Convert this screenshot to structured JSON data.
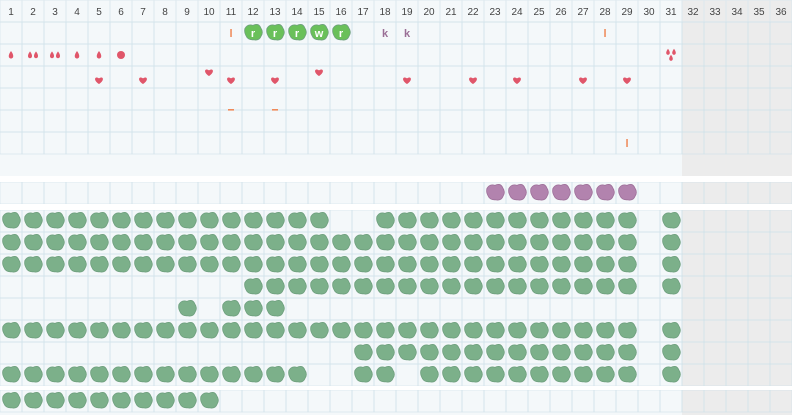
{
  "colors": {
    "page_bg": "#f4f8fa",
    "cell_border": "#dde8ee",
    "grid_line": "#cfe2ea",
    "band_separator": "#ffffff",
    "shaded_bg": "#ececec",
    "day_number_text": "#444444",
    "blob_green": "#7cb08a",
    "blob_green_dark": "#6e9f7e",
    "blob_bright_green": "#6ac05a",
    "blob_purple": "#b283ae",
    "symbol_red": "#e0566a",
    "symbol_orange": "#ef8a5a",
    "letter_purple": "#9a6f96",
    "letter_on_blob": "#ffffff"
  },
  "days": [
    "1",
    "2",
    "3",
    "4",
    "5",
    "6",
    "7",
    "8",
    "9",
    "10",
    "11",
    "12",
    "13",
    "14",
    "15",
    "16",
    "17",
    "18",
    "19",
    "20",
    "21",
    "22",
    "23",
    "24",
    "25",
    "26",
    "27",
    "28",
    "29",
    "30",
    "31",
    "32",
    "33",
    "34",
    "35",
    "36"
  ],
  "active_day_count": 31,
  "tracks": [
    {
      "name": "track-1",
      "band": 1,
      "blobs": [],
      "letters": [
        {
          "day": 11,
          "text": "l",
          "style": "plain-orange"
        },
        {
          "day": 12,
          "text": "r",
          "style": "on-blob"
        },
        {
          "day": 13,
          "text": "r",
          "style": "on-blob"
        },
        {
          "day": 14,
          "text": "r",
          "style": "on-blob"
        },
        {
          "day": 15,
          "text": "w",
          "style": "on-blob"
        },
        {
          "day": 16,
          "text": "r",
          "style": "on-blob"
        },
        {
          "day": 18,
          "text": "k",
          "style": "plain-purple"
        },
        {
          "day": 19,
          "text": "k",
          "style": "plain-purple"
        },
        {
          "day": 28,
          "text": "l",
          "style": "plain-orange"
        }
      ],
      "symbols": []
    },
    {
      "name": "track-2",
      "band": 1,
      "blobs": [],
      "letters": [],
      "symbols": [
        {
          "day": 1,
          "type": "drop",
          "count": 1
        },
        {
          "day": 2,
          "type": "drop",
          "count": 2
        },
        {
          "day": 3,
          "type": "drop",
          "count": 2
        },
        {
          "day": 4,
          "type": "drop",
          "count": 1
        },
        {
          "day": 5,
          "type": "drop",
          "count": 1
        },
        {
          "day": 6,
          "type": "dot",
          "count": 1
        },
        {
          "day": 31,
          "type": "drop",
          "count": 3
        }
      ]
    },
    {
      "name": "track-3",
      "band": 1,
      "blobs": [],
      "letters": [],
      "symbols": [
        {
          "day": 10,
          "type": "heart",
          "pos": "top"
        },
        {
          "day": 15,
          "type": "heart",
          "pos": "top"
        },
        {
          "day": 5,
          "type": "heart",
          "pos": "bottom"
        },
        {
          "day": 7,
          "type": "heart",
          "pos": "bottom"
        },
        {
          "day": 11,
          "type": "heart",
          "pos": "bottom"
        },
        {
          "day": 13,
          "type": "heart",
          "pos": "bottom"
        },
        {
          "day": 19,
          "type": "heart",
          "pos": "bottom"
        },
        {
          "day": 22,
          "type": "heart",
          "pos": "bottom"
        },
        {
          "day": 24,
          "type": "heart",
          "pos": "bottom"
        },
        {
          "day": 27,
          "type": "heart",
          "pos": "bottom"
        },
        {
          "day": 29,
          "type": "heart",
          "pos": "bottom"
        }
      ]
    },
    {
      "name": "track-4",
      "band": 1,
      "blobs": [],
      "letters": [],
      "symbols": [
        {
          "day": 11,
          "type": "dash"
        },
        {
          "day": 13,
          "type": "dash"
        }
      ]
    },
    {
      "name": "track-5",
      "band": 1,
      "blobs": [],
      "letters": [],
      "symbols": []
    },
    {
      "name": "track-6",
      "band": 1,
      "blobs": [],
      "letters": [
        {
          "day": 29,
          "text": "l",
          "style": "plain-orange"
        }
      ],
      "symbols": []
    },
    {
      "name": "track-7",
      "band": 2,
      "blobs": [
        {
          "color": "purple",
          "days": [
            23,
            24,
            25,
            26,
            27,
            28,
            29
          ]
        }
      ],
      "letters": [],
      "symbols": []
    },
    {
      "name": "track-8",
      "band": 3,
      "blobs": [
        {
          "color": "green",
          "days": [
            1,
            2,
            3,
            4,
            5,
            6,
            7,
            8,
            9,
            10,
            11,
            12,
            13,
            14,
            15,
            18,
            19,
            20,
            21,
            22,
            23,
            24,
            25,
            26,
            27,
            28,
            29,
            31
          ]
        }
      ],
      "letters": [],
      "symbols": []
    },
    {
      "name": "track-9",
      "band": 3,
      "blobs": [
        {
          "color": "green",
          "days": [
            1,
            2,
            3,
            4,
            5,
            6,
            7,
            8,
            9,
            10,
            11,
            12,
            13,
            14,
            15,
            16,
            17,
            18,
            19,
            20,
            21,
            22,
            23,
            24,
            25,
            26,
            27,
            28,
            29,
            31
          ]
        }
      ],
      "letters": [],
      "symbols": []
    },
    {
      "name": "track-10",
      "band": 3,
      "blobs": [
        {
          "color": "green",
          "days": [
            1,
            2,
            3,
            4,
            5,
            6,
            7,
            8,
            9,
            10,
            11,
            12,
            13,
            14,
            15,
            16,
            17,
            18,
            19,
            20,
            21,
            22,
            23,
            24,
            25,
            26,
            27,
            28,
            29,
            31
          ]
        }
      ],
      "letters": [],
      "symbols": []
    },
    {
      "name": "track-11",
      "band": 3,
      "blobs": [
        {
          "color": "green",
          "days": [
            12,
            13,
            14,
            15,
            16,
            17,
            18,
            19,
            20,
            21,
            22,
            23,
            24,
            25,
            26,
            27,
            28,
            29,
            31
          ]
        }
      ],
      "letters": [],
      "symbols": []
    },
    {
      "name": "track-12",
      "band": 3,
      "blobs": [
        {
          "color": "green",
          "days": [
            9,
            11,
            12,
            13
          ]
        }
      ],
      "letters": [],
      "symbols": []
    },
    {
      "name": "track-13",
      "band": 3,
      "blobs": [
        {
          "color": "green",
          "days": [
            1,
            2,
            3,
            4,
            5,
            6,
            7,
            8,
            9,
            10,
            11,
            12,
            13,
            14,
            15,
            16,
            17,
            18,
            19,
            20,
            21,
            22,
            23,
            24,
            25,
            26,
            27,
            28,
            29,
            31
          ]
        }
      ],
      "letters": [],
      "symbols": []
    },
    {
      "name": "track-14",
      "band": 3,
      "blobs": [
        {
          "color": "green",
          "days": [
            17,
            18,
            19,
            20,
            21,
            22,
            23,
            24,
            25,
            26,
            27,
            28,
            29,
            31
          ]
        }
      ],
      "letters": [],
      "symbols": []
    },
    {
      "name": "track-15",
      "band": 3,
      "blobs": [
        {
          "color": "green",
          "days": [
            1,
            2,
            3,
            4,
            5,
            6,
            7,
            8,
            9,
            10,
            11,
            12,
            13,
            14,
            17,
            18,
            20,
            21,
            22,
            23,
            24,
            25,
            26,
            27,
            28,
            29,
            31
          ]
        }
      ],
      "letters": [],
      "symbols": []
    },
    {
      "name": "track-16",
      "band": 4,
      "blobs": [
        {
          "color": "green",
          "days": [
            1,
            2,
            3,
            4,
            5,
            6,
            7,
            8,
            9,
            10
          ]
        }
      ],
      "letters": [],
      "symbols": []
    }
  ]
}
